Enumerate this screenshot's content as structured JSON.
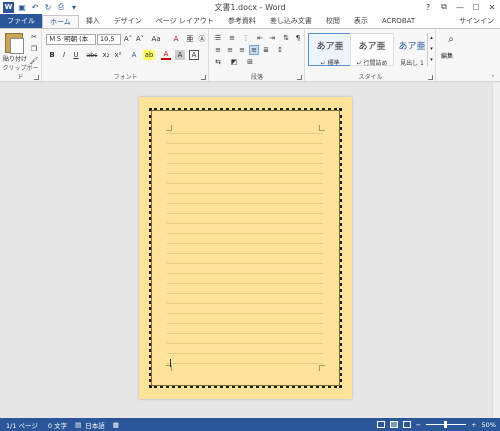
{
  "window": {
    "title": "文書1.docx - Word",
    "help": "?",
    "restore": "⧉",
    "minimize": "—",
    "maximize": "☐",
    "close": "✕"
  },
  "tabs": [
    {
      "label": "ファイル"
    },
    {
      "label": "ホーム"
    },
    {
      "label": "挿入"
    },
    {
      "label": "デザイン"
    },
    {
      "label": "ページ レイアウト"
    },
    {
      "label": "参考資料"
    },
    {
      "label": "差し込み文書"
    },
    {
      "label": "校閲"
    },
    {
      "label": "表示"
    },
    {
      "label": "ACROBAT"
    }
  ],
  "signin": "サインイン",
  "ribbon": {
    "clipboard": {
      "label": "クリップボード",
      "paste": "貼り付け"
    },
    "font": {
      "label": "フォント",
      "font_name": "ＭＳ 明朝 (本",
      "font_size": "10.5",
      "grow": "A˄",
      "shrink": "A˅",
      "case": "Aa",
      "clear": "A",
      "bold": "B",
      "italic": "I",
      "underline": "U",
      "strike": "abc",
      "sub": "x₂",
      "sup": "x²",
      "effects": "A",
      "highlight": "ab",
      "color": "A",
      "shade": "A",
      "border_char": "A"
    },
    "paragraph": {
      "label": "段落"
    },
    "styles": {
      "label": "スタイル",
      "items": [
        {
          "sample": "あア亜",
          "name": "↵ 標準"
        },
        {
          "sample": "あア亜",
          "name": "↵ 行間詰め"
        },
        {
          "sample": "あア亜",
          "name": "見出し 1"
        }
      ]
    },
    "editing": {
      "label": "編集"
    }
  },
  "status": {
    "page": "1/1 ページ",
    "words": "0 文字",
    "language": "日本語",
    "zoom_out": "−",
    "zoom_in": "+",
    "zoom": "50%",
    "zoom_level": 0.5
  }
}
